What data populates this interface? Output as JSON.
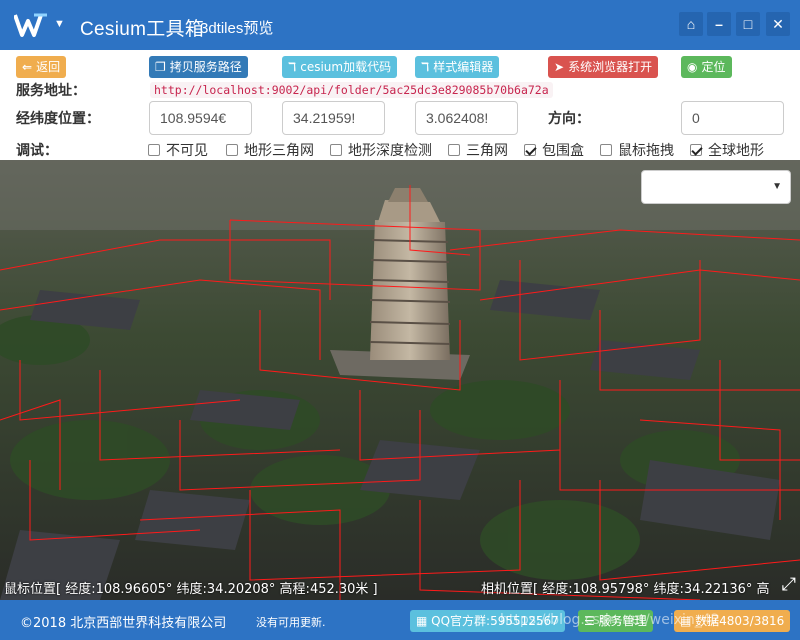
{
  "titlebar": {
    "app_title": "Cesium工具箱",
    "app_subtitle": "3dtiles预览",
    "home_glyph": "⌂",
    "minimize_glyph": "–",
    "maximize_glyph": "□",
    "close_glyph": "✕"
  },
  "toolbar": {
    "back_label": "返回",
    "copy_path_label": "拷贝服务路径",
    "cesium_code_label": "cesium加载代码",
    "style_editor_label": "样式编辑器",
    "open_browser_label": "系统浏览器打开",
    "locate_label": "定位",
    "service_label": "服务地址：",
    "service_url": "http://localhost:9002/api/folder/5ac25dc3e829085b70b6a72a",
    "lonlat_label": "经纬度位置：",
    "longitude": "108.9594€",
    "latitude": "34.21959!",
    "height": "3.062408!",
    "heading_label": "方向：",
    "heading": "0",
    "debug_label": "调试："
  },
  "debug_options": [
    {
      "label": "不可见",
      "checked": false
    },
    {
      "label": "地形三角网",
      "checked": false
    },
    {
      "label": "地形深度检测",
      "checked": false
    },
    {
      "label": "三角网",
      "checked": false
    },
    {
      "label": "包围盒",
      "checked": true
    },
    {
      "label": "鼠标拖拽",
      "checked": false
    },
    {
      "label": "全球地形",
      "checked": true
    }
  ],
  "viewer": {
    "mouse_position": "鼠标位置[ 经度:108.96605° 纬度:34.20208° 高程:452.30米 ]",
    "camera_position": "相机位置[ 经度:108.95798° 纬度:34.22136° 高",
    "layer_select_value": ""
  },
  "footer": {
    "copyright": "©2018 北京西部世界科技有限公司",
    "update_status": "没有可用更新.",
    "qq_group_label": "QQ官方群:595512567",
    "service_manage_label": "服务管理",
    "data_label": "数据4803/3816",
    "watermark": "https://blog.csdn.net/weixin_42"
  },
  "colors": {
    "brand_blue": "#2d73c4",
    "back_btn": "#f0ad4e",
    "primary_btn": "#337ab7",
    "info_btn": "#5bc0de",
    "danger_btn": "#d9534f",
    "success_btn": "#5cb85c",
    "bbox_red": "#ff1a1a"
  }
}
